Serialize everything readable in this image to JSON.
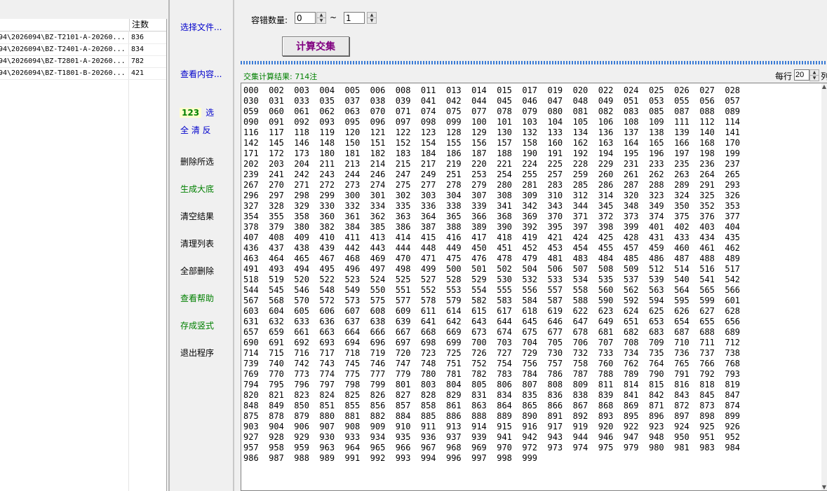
{
  "file_list": {
    "header_count": "注数",
    "rows": [
      {
        "name": "94\\2026094\\BZ-T2101-A-20260...",
        "count": "836"
      },
      {
        "name": "94\\2026094\\BZ-T2401-A-20260...",
        "count": "834"
      },
      {
        "name": "94\\2026094\\BZ-T2801-A-20260...",
        "count": "782"
      },
      {
        "name": "94\\2026094\\BZ-T1801-B-20260...",
        "count": "421"
      }
    ]
  },
  "commands": {
    "select_file": "选择文件...",
    "view_content": "查看内容...",
    "badge_123": "123",
    "select": "选",
    "all_clear_invert": "全 清 反",
    "delete_selected": "删除所选",
    "generate_base": "生成大底",
    "clear_results": "清空结果",
    "clean_list": "清理列表",
    "delete_all": "全部删除",
    "view_help": "查看帮助",
    "save_vertical": "存成竖式",
    "exit_program": "退出程序"
  },
  "tolerance": {
    "label": "容错数量:",
    "min": "0",
    "tilde": "~",
    "max": "1"
  },
  "calc_button": "计算交集",
  "result": {
    "title": "交集计算结果: 714注",
    "per_row_label": "每行",
    "per_row_value": "20",
    "per_row_suffix": "列",
    "numbers": [
      "000",
      "002",
      "003",
      "004",
      "005",
      "006",
      "008",
      "011",
      "013",
      "014",
      "015",
      "017",
      "019",
      "020",
      "022",
      "024",
      "025",
      "026",
      "027",
      "028",
      "030",
      "031",
      "033",
      "035",
      "037",
      "038",
      "039",
      "041",
      "042",
      "044",
      "045",
      "046",
      "047",
      "048",
      "049",
      "051",
      "053",
      "055",
      "056",
      "057",
      "059",
      "060",
      "061",
      "062",
      "063",
      "070",
      "071",
      "074",
      "075",
      "077",
      "078",
      "079",
      "080",
      "081",
      "082",
      "083",
      "085",
      "087",
      "088",
      "089",
      "090",
      "091",
      "092",
      "093",
      "095",
      "096",
      "097",
      "098",
      "099",
      "100",
      "101",
      "103",
      "104",
      "105",
      "106",
      "108",
      "109",
      "111",
      "112",
      "114",
      "116",
      "117",
      "118",
      "119",
      "120",
      "121",
      "122",
      "123",
      "128",
      "129",
      "130",
      "132",
      "133",
      "134",
      "136",
      "137",
      "138",
      "139",
      "140",
      "141",
      "142",
      "145",
      "146",
      "148",
      "150",
      "151",
      "152",
      "154",
      "155",
      "156",
      "157",
      "158",
      "160",
      "162",
      "163",
      "164",
      "165",
      "166",
      "168",
      "170",
      "171",
      "172",
      "173",
      "180",
      "181",
      "182",
      "183",
      "184",
      "186",
      "187",
      "188",
      "190",
      "191",
      "192",
      "194",
      "195",
      "196",
      "197",
      "198",
      "199",
      "202",
      "203",
      "204",
      "211",
      "213",
      "214",
      "215",
      "217",
      "219",
      "220",
      "221",
      "224",
      "225",
      "228",
      "229",
      "231",
      "233",
      "235",
      "236",
      "237",
      "239",
      "241",
      "242",
      "243",
      "244",
      "246",
      "247",
      "249",
      "251",
      "253",
      "254",
      "255",
      "257",
      "259",
      "260",
      "261",
      "262",
      "263",
      "264",
      "265",
      "267",
      "270",
      "271",
      "272",
      "273",
      "274",
      "275",
      "277",
      "278",
      "279",
      "280",
      "281",
      "283",
      "285",
      "286",
      "287",
      "288",
      "289",
      "291",
      "293",
      "296",
      "297",
      "298",
      "299",
      "300",
      "301",
      "302",
      "303",
      "304",
      "307",
      "308",
      "309",
      "310",
      "312",
      "314",
      "320",
      "323",
      "324",
      "325",
      "326",
      "327",
      "328",
      "329",
      "330",
      "332",
      "334",
      "335",
      "336",
      "338",
      "339",
      "341",
      "342",
      "343",
      "344",
      "345",
      "348",
      "349",
      "350",
      "352",
      "353",
      "354",
      "355",
      "358",
      "360",
      "361",
      "362",
      "363",
      "364",
      "365",
      "366",
      "368",
      "369",
      "370",
      "371",
      "372",
      "373",
      "374",
      "375",
      "376",
      "377",
      "378",
      "379",
      "380",
      "382",
      "384",
      "385",
      "386",
      "387",
      "388",
      "389",
      "390",
      "392",
      "395",
      "397",
      "398",
      "399",
      "401",
      "402",
      "403",
      "404",
      "407",
      "408",
      "409",
      "410",
      "411",
      "413",
      "414",
      "415",
      "416",
      "417",
      "418",
      "419",
      "421",
      "424",
      "425",
      "428",
      "431",
      "433",
      "434",
      "435",
      "436",
      "437",
      "438",
      "439",
      "442",
      "443",
      "444",
      "448",
      "449",
      "450",
      "451",
      "452",
      "453",
      "454",
      "455",
      "457",
      "459",
      "460",
      "461",
      "462",
      "463",
      "464",
      "465",
      "467",
      "468",
      "469",
      "470",
      "471",
      "475",
      "476",
      "478",
      "479",
      "481",
      "483",
      "484",
      "485",
      "486",
      "487",
      "488",
      "489",
      "491",
      "493",
      "494",
      "495",
      "496",
      "497",
      "498",
      "499",
      "500",
      "501",
      "502",
      "504",
      "506",
      "507",
      "508",
      "509",
      "512",
      "514",
      "516",
      "517",
      "518",
      "519",
      "520",
      "522",
      "523",
      "524",
      "525",
      "527",
      "528",
      "529",
      "530",
      "532",
      "533",
      "534",
      "535",
      "537",
      "539",
      "540",
      "541",
      "542",
      "544",
      "545",
      "546",
      "548",
      "549",
      "550",
      "551",
      "552",
      "553",
      "554",
      "555",
      "556",
      "557",
      "558",
      "560",
      "562",
      "563",
      "564",
      "565",
      "566",
      "567",
      "568",
      "570",
      "572",
      "573",
      "575",
      "577",
      "578",
      "579",
      "582",
      "583",
      "584",
      "587",
      "588",
      "590",
      "592",
      "594",
      "595",
      "599",
      "601",
      "603",
      "604",
      "605",
      "606",
      "607",
      "608",
      "609",
      "611",
      "614",
      "615",
      "617",
      "618",
      "619",
      "622",
      "623",
      "624",
      "625",
      "626",
      "627",
      "628",
      "631",
      "632",
      "633",
      "636",
      "637",
      "638",
      "639",
      "641",
      "642",
      "643",
      "644",
      "645",
      "646",
      "647",
      "649",
      "651",
      "653",
      "654",
      "655",
      "656",
      "657",
      "659",
      "661",
      "663",
      "664",
      "666",
      "667",
      "668",
      "669",
      "673",
      "674",
      "675",
      "677",
      "678",
      "681",
      "682",
      "683",
      "687",
      "688",
      "689",
      "690",
      "691",
      "692",
      "693",
      "694",
      "696",
      "697",
      "698",
      "699",
      "700",
      "703",
      "704",
      "705",
      "706",
      "707",
      "708",
      "709",
      "710",
      "711",
      "712",
      "714",
      "715",
      "716",
      "717",
      "718",
      "719",
      "720",
      "723",
      "725",
      "726",
      "727",
      "729",
      "730",
      "732",
      "733",
      "734",
      "735",
      "736",
      "737",
      "738",
      "739",
      "740",
      "742",
      "743",
      "745",
      "746",
      "747",
      "748",
      "751",
      "752",
      "754",
      "756",
      "757",
      "758",
      "760",
      "762",
      "764",
      "765",
      "766",
      "768",
      "769",
      "770",
      "773",
      "774",
      "775",
      "777",
      "779",
      "780",
      "781",
      "782",
      "783",
      "784",
      "786",
      "787",
      "788",
      "789",
      "790",
      "791",
      "792",
      "793",
      "794",
      "795",
      "796",
      "797",
      "798",
      "799",
      "801",
      "803",
      "804",
      "805",
      "806",
      "807",
      "808",
      "809",
      "811",
      "814",
      "815",
      "816",
      "818",
      "819",
      "820",
      "821",
      "823",
      "824",
      "825",
      "826",
      "827",
      "828",
      "829",
      "831",
      "834",
      "835",
      "836",
      "838",
      "839",
      "841",
      "842",
      "843",
      "845",
      "847",
      "848",
      "849",
      "850",
      "851",
      "855",
      "856",
      "857",
      "858",
      "861",
      "863",
      "864",
      "865",
      "866",
      "867",
      "868",
      "869",
      "871",
      "872",
      "873",
      "874",
      "875",
      "878",
      "879",
      "880",
      "881",
      "882",
      "884",
      "885",
      "886",
      "888",
      "889",
      "890",
      "891",
      "892",
      "893",
      "895",
      "896",
      "897",
      "898",
      "899",
      "903",
      "904",
      "906",
      "907",
      "908",
      "909",
      "910",
      "911",
      "913",
      "914",
      "915",
      "916",
      "917",
      "919",
      "920",
      "922",
      "923",
      "924",
      "925",
      "926",
      "927",
      "928",
      "929",
      "930",
      "933",
      "934",
      "935",
      "936",
      "937",
      "939",
      "941",
      "942",
      "943",
      "944",
      "946",
      "947",
      "948",
      "950",
      "951",
      "952",
      "957",
      "958",
      "959",
      "963",
      "964",
      "965",
      "966",
      "967",
      "968",
      "969",
      "970",
      "972",
      "973",
      "974",
      "975",
      "979",
      "980",
      "981",
      "983",
      "984",
      "986",
      "987",
      "988",
      "989",
      "991",
      "992",
      "993",
      "994",
      "996",
      "997",
      "998",
      "999"
    ]
  }
}
